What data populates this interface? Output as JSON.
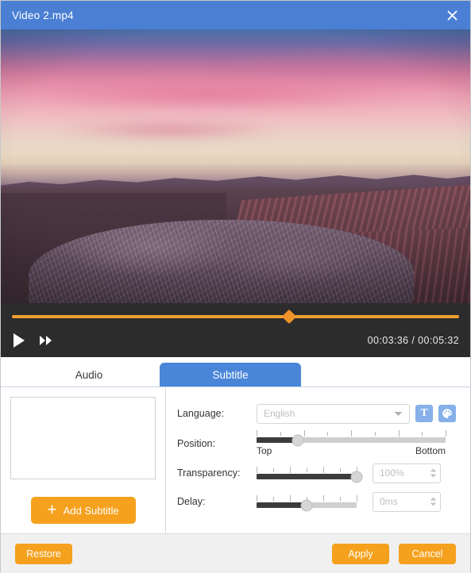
{
  "window": {
    "title": "Video 2.mp4",
    "close_icon": "close-icon"
  },
  "player": {
    "play_icon": "play-icon",
    "forward_icon": "fast-forward-icon",
    "current_time": "00:03:36",
    "separator": "/",
    "total_time": "00:05:32",
    "progress_percent": 62,
    "accent_color": "#f0a030"
  },
  "tabs": [
    {
      "label": "Audio",
      "active": false
    },
    {
      "label": "Subtitle",
      "active": true
    }
  ],
  "subtitle_panel": {
    "list_items": [],
    "add_button": {
      "label": "Add Subtitle",
      "icon": "plus-icon",
      "color": "#f5a11e"
    }
  },
  "settings": {
    "language": {
      "label": "Language:",
      "value": "",
      "placeholder": "English",
      "caret_icon": "chevron-down-icon",
      "font_button": {
        "icon": "text-format-icon",
        "glyph": "T"
      },
      "color_button": {
        "icon": "color-palette-icon"
      }
    },
    "position": {
      "label": "Position:",
      "min_label": "Top",
      "max_label": "Bottom",
      "value_percent": 22,
      "tick_count": 9
    },
    "transparency": {
      "label": "Transparency:",
      "value_percent": 100,
      "placeholder": "100%",
      "value": "",
      "tick_count": 7
    },
    "delay": {
      "label": "Delay:",
      "value_percent": 50,
      "placeholder": "0ms",
      "value": "",
      "tick_count": 7
    }
  },
  "footer": {
    "restore_label": "Restore",
    "apply_label": "Apply",
    "cancel_label": "Cancel"
  }
}
